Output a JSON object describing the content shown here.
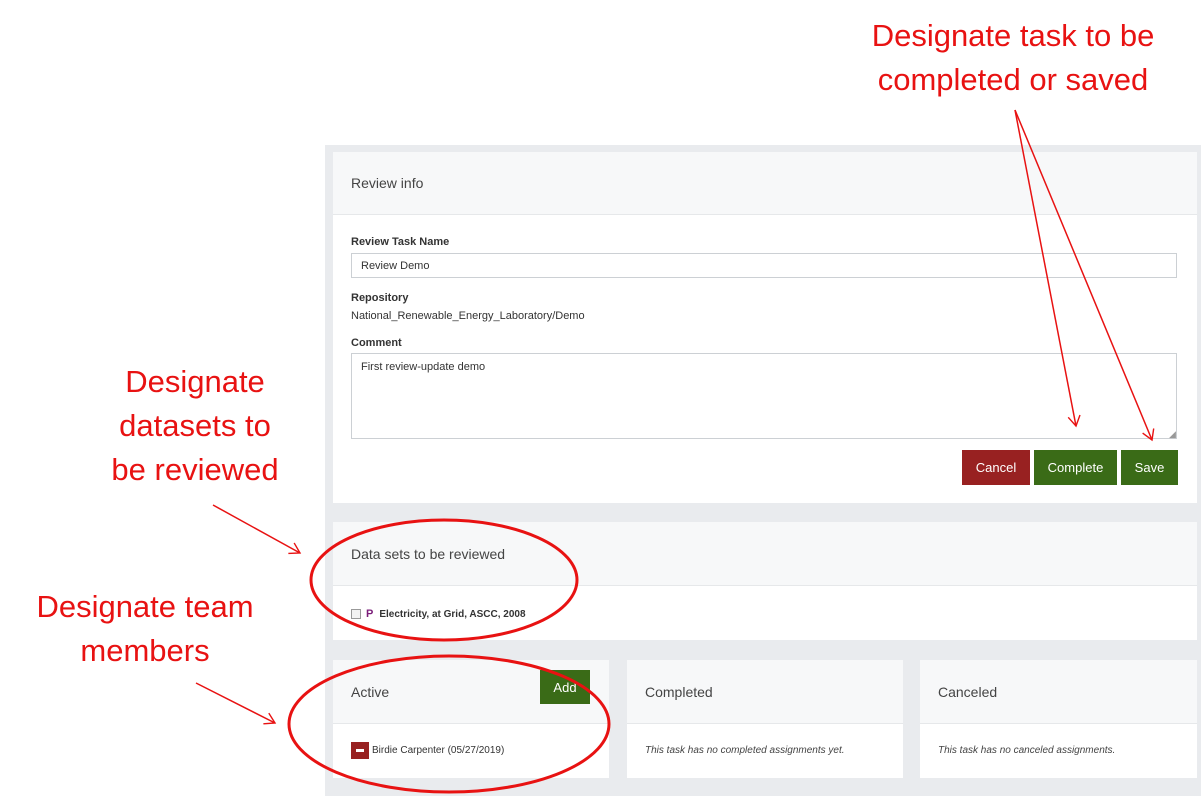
{
  "review_card": {
    "header": "Review info",
    "task_name_label": "Review Task Name",
    "task_name_value": "Review Demo",
    "repository_label": "Repository",
    "repository_value": "National_Renewable_Energy_Laboratory/Demo",
    "comment_label": "Comment",
    "comment_value": "First review-update demo",
    "buttons": {
      "cancel": "Cancel",
      "complete": "Complete",
      "save": "Save"
    }
  },
  "datasets_card": {
    "header": "Data sets to be reviewed",
    "items": [
      {
        "badge": "P",
        "name": "Electricity, at Grid, ASCC, 2008",
        "checked": false
      }
    ]
  },
  "members": {
    "active": {
      "header": "Active",
      "add_label": "Add",
      "items": [
        {
          "name": "Birdie Carpenter (05/27/2019)"
        }
      ]
    },
    "completed": {
      "header": "Completed",
      "empty_text": "This task has no completed assignments yet."
    },
    "canceled": {
      "header": "Canceled",
      "empty_text": "This task has no canceled assignments."
    }
  },
  "annotations": {
    "top_right": [
      "Designate task to be",
      "completed or saved"
    ],
    "datasets": [
      "Designate",
      "datasets to",
      "be reviewed"
    ],
    "team": [
      "Designate team",
      "members"
    ]
  },
  "colors": {
    "cancel": "#982121",
    "confirm": "#3a6b17",
    "annotation": "#e81212",
    "badge": "#7b1e7a"
  }
}
